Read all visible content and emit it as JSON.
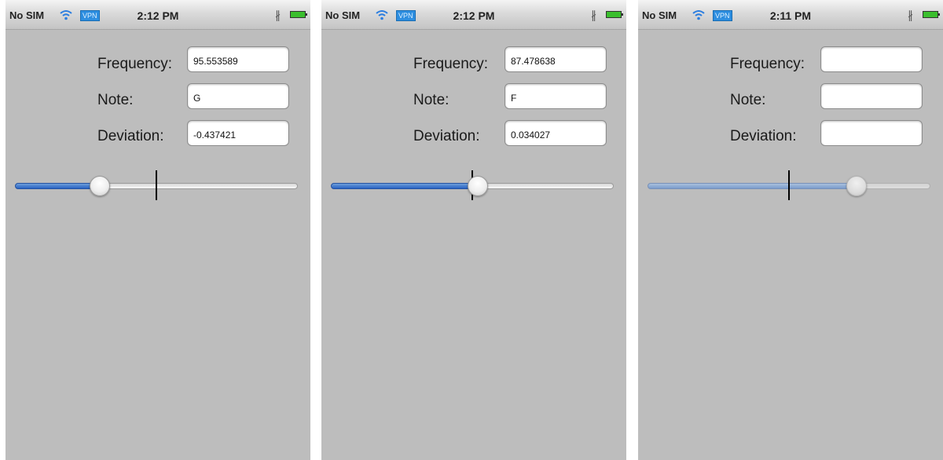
{
  "statusbar": {
    "carrier": "No SIM",
    "vpn_label": "VPN",
    "icons": [
      "wifi-icon",
      "vpn-badge",
      "bluetooth-icon",
      "battery-icon"
    ]
  },
  "labels": {
    "frequency": "Frequency:",
    "note": "Note:",
    "deviation": "Deviation:"
  },
  "screens": [
    {
      "time": "2:12 PM",
      "frequency": "95.553589",
      "note": "G",
      "deviation": "-0.437421",
      "slider_value": 0.3,
      "marker_value": 0.5,
      "enabled": true
    },
    {
      "time": "2:12 PM",
      "frequency": "87.478638",
      "note": "F",
      "deviation": "0.034027",
      "slider_value": 0.52,
      "marker_value": 0.5,
      "enabled": true
    },
    {
      "time": "2:11 PM",
      "frequency": "",
      "note": "",
      "deviation": "",
      "slider_value": 0.74,
      "marker_value": 0.5,
      "enabled": false
    }
  ],
  "colors": {
    "screen_bg": "#bdbdbd",
    "slider_fill": "#2862c3",
    "marker": "#000000"
  }
}
